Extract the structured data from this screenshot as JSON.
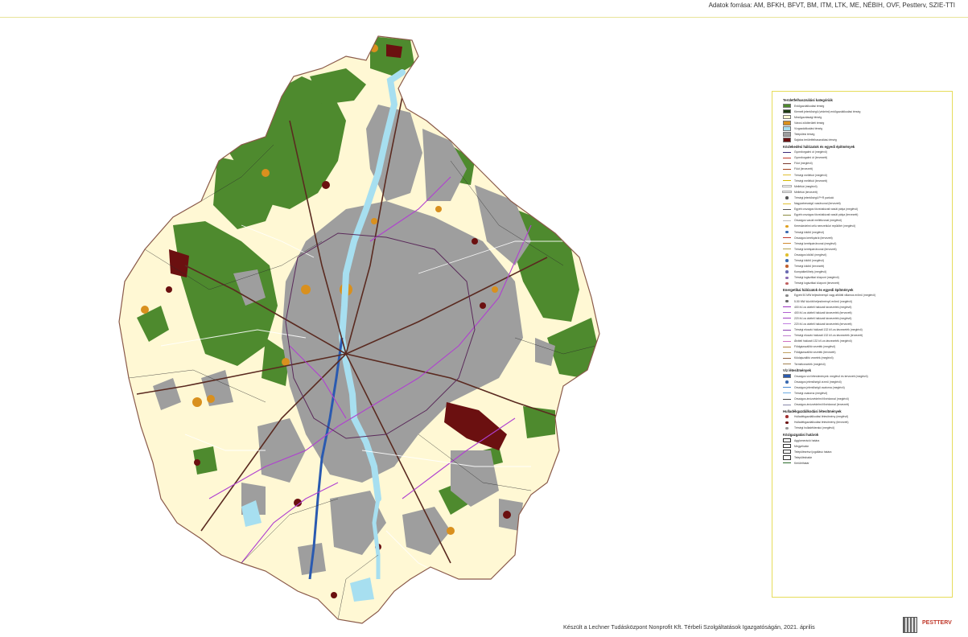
{
  "source_note": "Adatok forrása: AM, BFKH, BFVT, BM, ITM, LTK, ME, NÉBIH, OVF, Pestterv, SZIE-TTI",
  "credit": "Készült a Lechner Tudásközpont Nonprofit Kft. Térbeli Szolgáltatások Igazgatóságán, 2021. április",
  "logo_text": "PESTTERV",
  "colors": {
    "forest": "#4e8a2e",
    "protection_forest": "#1e3d14",
    "agricultural": "#fff8d4",
    "urban_green": "#d9901e",
    "water": "#a7dff0",
    "built_up": "#9e9e9e",
    "special": "#6b1010",
    "legend_border": "#e6dc5a"
  },
  "legend": {
    "sections": [
      {
        "title": "Területfelhasználási kategóriák",
        "items": [
          {
            "label": "Erdőgazdálkodási térség",
            "symbol": "patch",
            "color": "#4e8a2e"
          },
          {
            "label": "Kiemelt jelentőségű (védelmi) erdőgazdálkodási térség",
            "symbol": "patch",
            "color": "#1e3d14"
          },
          {
            "label": "Mezőgazdasági térség",
            "symbol": "patch",
            "color": "#fff8d4"
          },
          {
            "label": "Városi zöldterületi térség",
            "symbol": "patch",
            "color": "#d9901e"
          },
          {
            "label": "Vízgazdálkodási térség",
            "symbol": "patch",
            "color": "#a7dff0"
          },
          {
            "label": "Települési térség",
            "symbol": "patch",
            "color": "#9e9e9e"
          },
          {
            "label": "Sajátos területfelhasználású térség",
            "symbol": "patch",
            "color": "#6b1010"
          }
        ]
      },
      {
        "title": "Közlekedési hálózatok és egyedi építmények",
        "items": [
          {
            "label": "Gyorsforgalmi út (meglévő)",
            "symbol": "line",
            "color": "#3b2a78"
          },
          {
            "label": "Gyorsforgalmi út (tervezett)",
            "symbol": "line",
            "color": "#c0392b"
          },
          {
            "label": "Főút (meglévő)",
            "symbol": "line",
            "color": "#7a3b2e"
          },
          {
            "label": "Főút (tervezett)",
            "symbol": "line",
            "color": "#a0401c"
          },
          {
            "label": "Térségi mellékút (meglévő)",
            "symbol": "line",
            "color": "#e0c030"
          },
          {
            "label": "Térségi mellékút (tervezett)",
            "symbol": "line",
            "color": "#d4b800"
          },
          {
            "label": "Mellékút (meglévő)",
            "symbol": "line",
            "color": "#ffffff"
          },
          {
            "label": "Mellékút (tervezett)",
            "symbol": "line",
            "color": "#eeeeee"
          },
          {
            "label": "Térségi jelentőségű P+R parkoló",
            "symbol": "dot",
            "color": "#555555"
          },
          {
            "label": "Nagysebességű vasútvonal (tervezett)",
            "symbol": "line",
            "color": "#e0c030"
          },
          {
            "label": "Egyéb országos törzshálózati vasúti pálya (meglévő)",
            "symbol": "line",
            "color": "#555555"
          },
          {
            "label": "Egyéb országos törzshálózati vasúti pálya (tervezett)",
            "symbol": "line",
            "color": "#8a8a40"
          },
          {
            "label": "Országos vasúti mellékvonal (meglévő)",
            "symbol": "line",
            "color": "#bbbbbb"
          },
          {
            "label": "Kereskedelmi célú nemzetközi repülőtér (meglévő)",
            "symbol": "dot",
            "color": "#e0a020"
          },
          {
            "label": "Térségi kikötő (meglévő)",
            "symbol": "dot",
            "color": "#3a6ab0"
          },
          {
            "label": "Országos kerékpárút (tervezett)",
            "symbol": "line",
            "color": "#c0392b"
          },
          {
            "label": "Térségi kerékpárútvonal (meglévő)",
            "symbol": "line",
            "color": "#d08a30"
          },
          {
            "label": "Térségi kerékpárútvonal (tervezett)",
            "symbol": "line",
            "color": "#b0a050"
          },
          {
            "label": "Országos kikötő (meglévő)",
            "symbol": "dot",
            "color": "#e0c030"
          },
          {
            "label": "Térségi kikötő (meglévő)",
            "symbol": "dot",
            "color": "#3a6ab0"
          },
          {
            "label": "Térségi kikötő (tervezett)",
            "symbol": "dot",
            "color": "#c06030"
          },
          {
            "label": "Kompátkelőhely (meglévő)",
            "symbol": "dot",
            "color": "#6a6ab0"
          },
          {
            "label": "Térségi logisztikai központ (meglévő)",
            "symbol": "dot",
            "color": "#8a6ab0"
          },
          {
            "label": "Térségi logisztikai központ (tervezett)",
            "symbol": "dot",
            "color": "#c06060"
          }
        ]
      },
      {
        "title": "Energetikai hálózatok és egyedi építmények",
        "items": [
          {
            "label": "Egyéb 50 MW teljesítményű vagy afölötti villamos erőmű (meglévő)",
            "symbol": "dot",
            "color": "#888888"
          },
          {
            "label": "5-50 MW közötti teljesítményű erőmű (meglévő)",
            "symbol": "dot",
            "color": "#666666"
          },
          {
            "label": "400 kV-os átviteli hálózati távvezeték (meglévő)",
            "symbol": "line",
            "color": "#9b30c0"
          },
          {
            "label": "400 kV-os átviteli hálózati távvezeték (tervezett)",
            "symbol": "line",
            "color": "#b060d0"
          },
          {
            "label": "220 kV-os átviteli hálózati távvezeték (meglévő)",
            "symbol": "line",
            "color": "#a040c0"
          },
          {
            "label": "220 kV-os átviteli hálózati távvezeték (tervezett)",
            "symbol": "line",
            "color": "#c080e0"
          },
          {
            "label": "Térségi elosztó hálózati 132 kV-os távvezeték (meglévő)",
            "symbol": "line",
            "color": "#8a40b0"
          },
          {
            "label": "Térségi elosztó hálózati 132 kV-os távvezeték (tervezett)",
            "symbol": "line",
            "color": "#c080d0"
          },
          {
            "label": "Átviteli hálózati 132 kV-os távvezeték (meglévő)",
            "symbol": "line",
            "color": "#d070c0"
          },
          {
            "label": "Földgázszállító vezeték (meglévő)",
            "symbol": "line",
            "color": "#b08040"
          },
          {
            "label": "Földgázszállító vezeték (tervezett)",
            "symbol": "line",
            "color": "#c0a060"
          },
          {
            "label": "Kőolajszállító vezeték (meglévő)",
            "symbol": "line",
            "color": "#906040"
          },
          {
            "label": "Termékvezeték (meglévő)",
            "symbol": "line",
            "color": "#a08050"
          }
        ]
      },
      {
        "title": "Víz létesítmények",
        "items": [
          {
            "label": "Országos vízi létesítmények: meglévő és tervezett (meglévő)",
            "symbol": "patch",
            "color": "#2a5ab0"
          },
          {
            "label": "Országos jelentőségű vízmű (meglévő)",
            "symbol": "dot",
            "color": "#3a6ab0"
          },
          {
            "label": "Országos jelentőségű csatorna (meglévő)",
            "symbol": "line",
            "color": "#4a8ad0"
          },
          {
            "label": "Térségi csatorna (meglévő)",
            "symbol": "line",
            "color": "#6aaae0"
          },
          {
            "label": "Országos árvízvédelmi fővédvonal (meglévő)",
            "symbol": "line",
            "color": "#444444"
          },
          {
            "label": "Országos árvízvédelmi fővédvonal (tervezett)",
            "symbol": "line",
            "color": "#8888aa"
          }
        ]
      },
      {
        "title": "Hulladékgazdálkodási létesítmények",
        "items": [
          {
            "label": "Hulladékgazdálkodási létesítmény (meglévő)",
            "symbol": "dot",
            "color": "#a03030"
          },
          {
            "label": "Hulladékgazdálkodási létesítmény (tervezett)",
            "symbol": "dot",
            "color": "#6b1010"
          },
          {
            "label": "Térségi hulladéklerakó (meglévő)",
            "symbol": "dot",
            "color": "#999999"
          }
        ]
      },
      {
        "title": "Közigazgatási határok",
        "items": [
          {
            "label": "Agglomeráció határa",
            "symbol": "box",
            "color": "#ffffff"
          },
          {
            "label": "Megyehatár",
            "symbol": "box",
            "color": "#ffffff"
          },
          {
            "label": "Településrészi jogállású határa",
            "symbol": "box",
            "color": "#ffffff"
          },
          {
            "label": "Településhatár",
            "symbol": "box",
            "color": "#ffffff"
          },
          {
            "label": "Kerülethatár",
            "symbol": "line",
            "color": "#2a6a2a"
          }
        ]
      }
    ]
  }
}
